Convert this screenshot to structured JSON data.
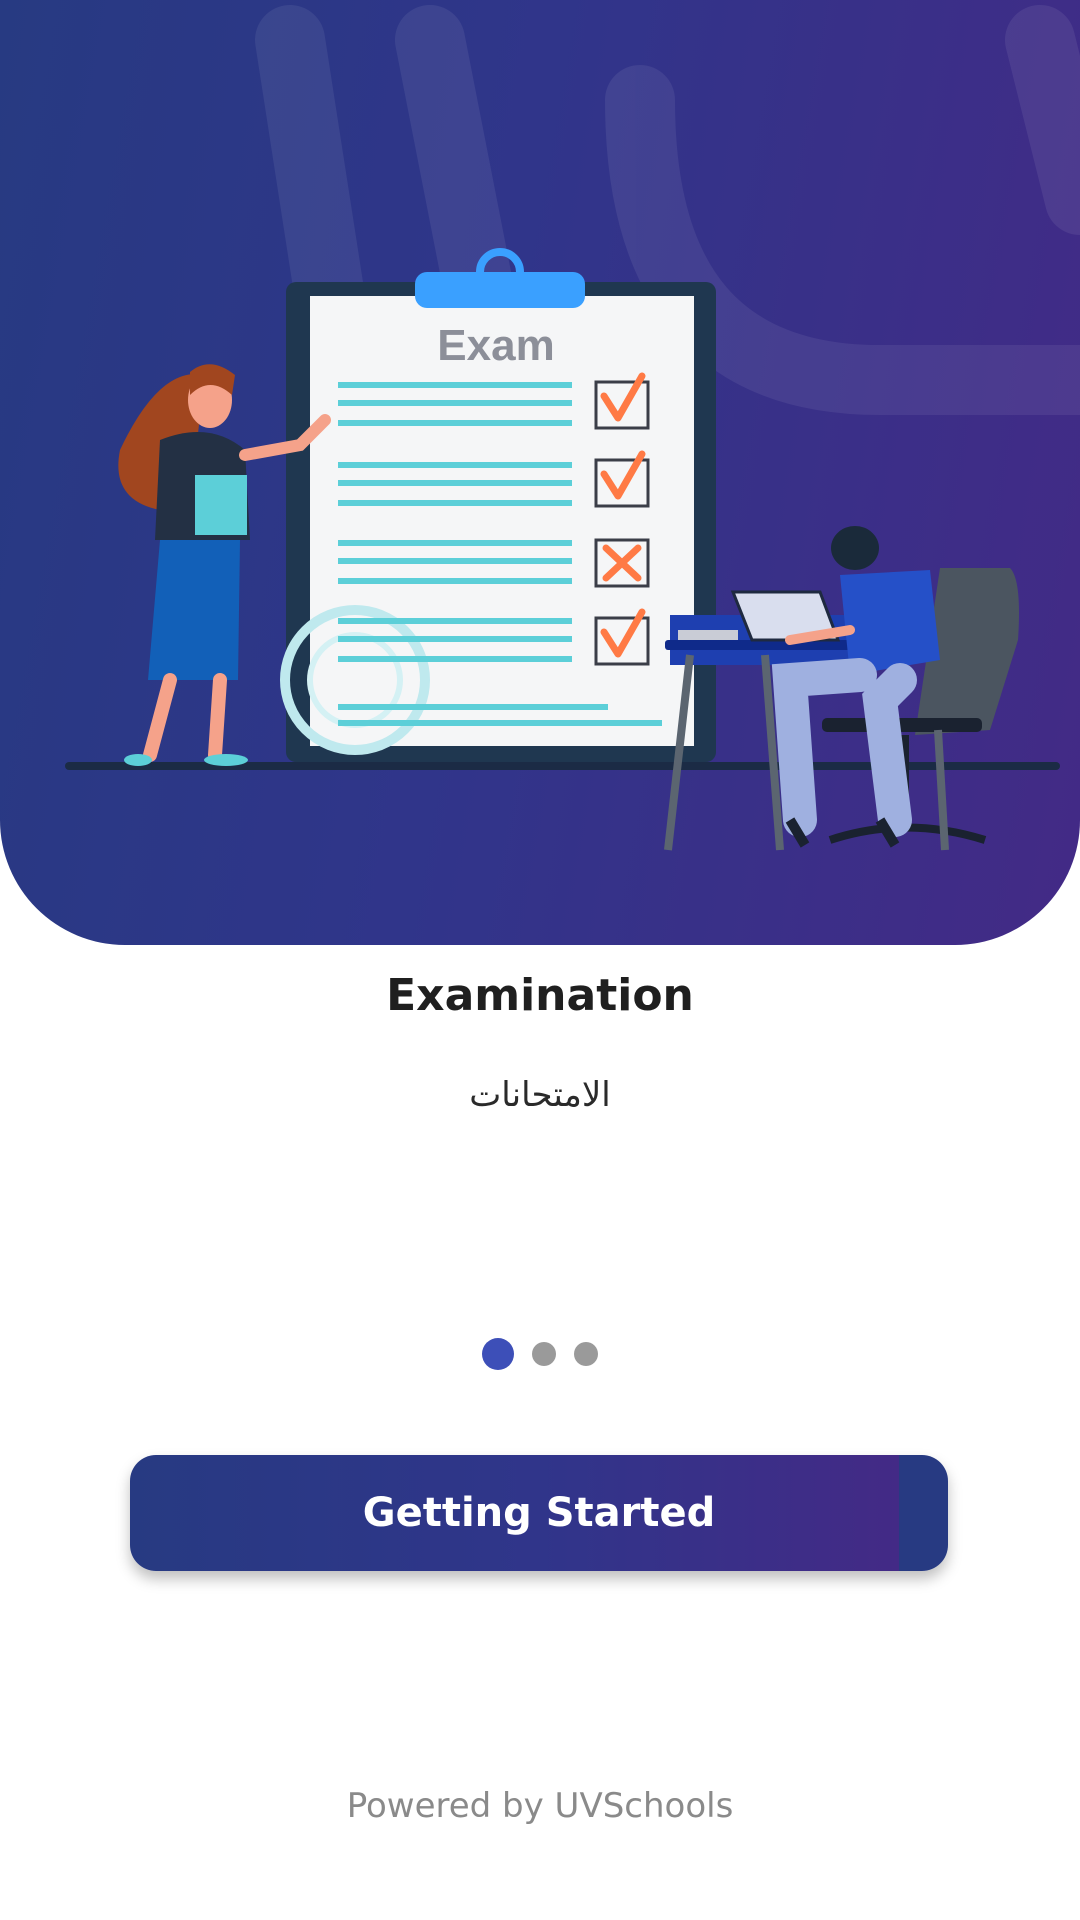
{
  "onboarding": {
    "illustration": {
      "clipboard_heading": "Exam"
    },
    "title": "Examination",
    "subtitle": "الامتحانات",
    "pager": {
      "total": 3,
      "active_index": 0
    },
    "cta_label": "Getting Started",
    "footer": "Powered by UVSchools"
  },
  "colors": {
    "brand_gradient_start": "#273a82",
    "brand_gradient_end": "#432a86",
    "active_dot": "#3d4fb8",
    "inactive_dot": "#9a9a9a",
    "check_orange": "#ff7a45",
    "line_teal": "#5ccfd8"
  }
}
